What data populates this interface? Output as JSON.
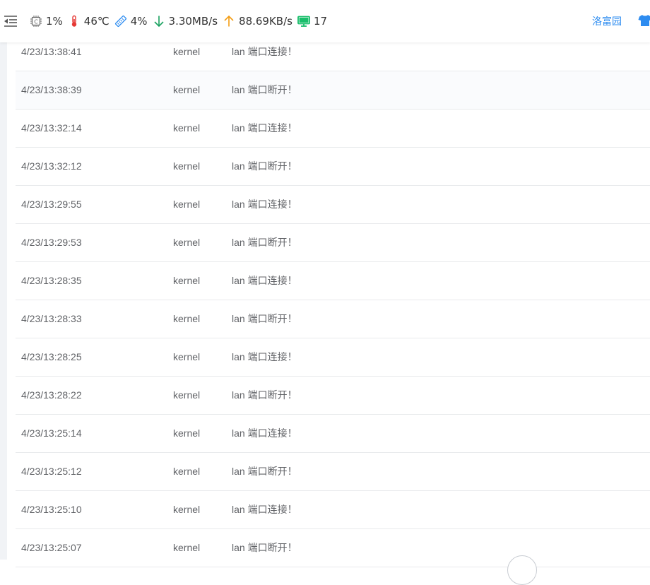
{
  "header": {
    "stats": [
      {
        "name": "cpu",
        "icon": "cpu-icon",
        "value": "1%"
      },
      {
        "name": "temperature",
        "icon": "thermometer-icon",
        "value": "46℃"
      },
      {
        "name": "memory",
        "icon": "memory-icon",
        "value": "4%"
      },
      {
        "name": "download",
        "icon": "arrow-down-icon",
        "value": "3.30MB/s"
      },
      {
        "name": "upload",
        "icon": "arrow-up-icon",
        "value": "88.69KB/s"
      },
      {
        "name": "devices",
        "icon": "monitor-icon",
        "value": "17"
      }
    ],
    "brand_link": "洛富园",
    "colors": {
      "cpu": "#666666",
      "temperature": "#e53935",
      "memory": "#2d8cf0",
      "download": "#19a15f",
      "upload": "#f39c12",
      "devices": "#19be6b",
      "link": "#2d8cf0"
    }
  },
  "logs": [
    {
      "time": "4/23/13:38:41",
      "source": "kernel",
      "message": "lan 端口连接！"
    },
    {
      "time": "4/23/13:38:39",
      "source": "kernel",
      "message": "lan 端口断开！"
    },
    {
      "time": "4/23/13:32:14",
      "source": "kernel",
      "message": "lan 端口连接！"
    },
    {
      "time": "4/23/13:32:12",
      "source": "kernel",
      "message": "lan 端口断开！"
    },
    {
      "time": "4/23/13:29:55",
      "source": "kernel",
      "message": "lan 端口连接！"
    },
    {
      "time": "4/23/13:29:53",
      "source": "kernel",
      "message": "lan 端口断开！"
    },
    {
      "time": "4/23/13:28:35",
      "source": "kernel",
      "message": "lan 端口连接！"
    },
    {
      "time": "4/23/13:28:33",
      "source": "kernel",
      "message": "lan 端口断开！"
    },
    {
      "time": "4/23/13:28:25",
      "source": "kernel",
      "message": "lan 端口连接！"
    },
    {
      "time": "4/23/13:28:22",
      "source": "kernel",
      "message": "lan 端口断开！"
    },
    {
      "time": "4/23/13:25:14",
      "source": "kernel",
      "message": "lan 端口连接！"
    },
    {
      "time": "4/23/13:25:12",
      "source": "kernel",
      "message": "lan 端口断开！"
    },
    {
      "time": "4/23/13:25:10",
      "source": "kernel",
      "message": "lan 端口连接！"
    },
    {
      "time": "4/23/13:25:07",
      "source": "kernel",
      "message": "lan 端口断开！"
    }
  ]
}
